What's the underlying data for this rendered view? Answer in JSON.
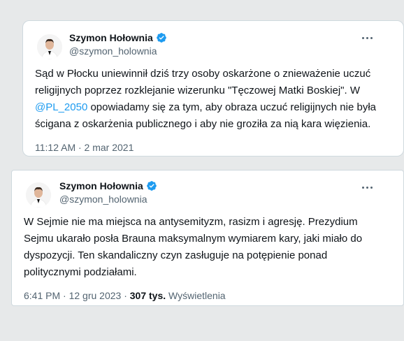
{
  "tweets": [
    {
      "author": {
        "name": "Szymon Hołownia",
        "handle": "@szymon_holownia"
      },
      "text_lines": [
        {
          "before": "Sąd w Płocku uniewinnił dziś trzy osoby oskarżone o znieważenie uczuć",
          "mention": "",
          "after": ""
        },
        {
          "before": "religijnych poprzez rozklejanie wizerunku \"Tęczowej Matki Boskiej\". W",
          "mention": "",
          "after": ""
        },
        {
          "before": "",
          "mention": "@PL_2050",
          "after": " opowiadamy się za tym, aby obraza uczuć religijnych nie była"
        },
        {
          "before": "ścigana z oskarżenia publicznego i aby nie groziła za nią kara więzienia.",
          "mention": "",
          "after": ""
        }
      ],
      "timestamp": "11:12 AM · 2 mar 2021",
      "views_count": "",
      "views_label": ""
    },
    {
      "author": {
        "name": "Szymon Hołownia",
        "handle": "@szymon_holownia"
      },
      "text_lines": [
        {
          "before": "W Sejmie nie ma miejsca na antysemityzm, rasizm i agresję. Prezydium",
          "mention": "",
          "after": ""
        },
        {
          "before": "Sejmu ukarało posła Brauna maksymalnym wymiarem kary, jaki miało do",
          "mention": "",
          "after": ""
        },
        {
          "before": "dyspozycji. Ten skandaliczny czyn zasługuje na potępienie ponad",
          "mention": "",
          "after": ""
        },
        {
          "before": "politycznymi podziałami.",
          "mention": "",
          "after": ""
        }
      ],
      "timestamp": "6:41 PM · 12 gru 2023 · ",
      "views_count": "307 tys.",
      "views_label": " Wyświetlenia"
    }
  ],
  "icons": {
    "verified": "verified-badge-icon",
    "more": "more-horizontal-icon"
  },
  "colors": {
    "accent": "#1d9bf0",
    "text_primary": "#0f1419",
    "text_secondary": "#536471",
    "border": "#cfd9de",
    "background": "#e7e9ea"
  }
}
